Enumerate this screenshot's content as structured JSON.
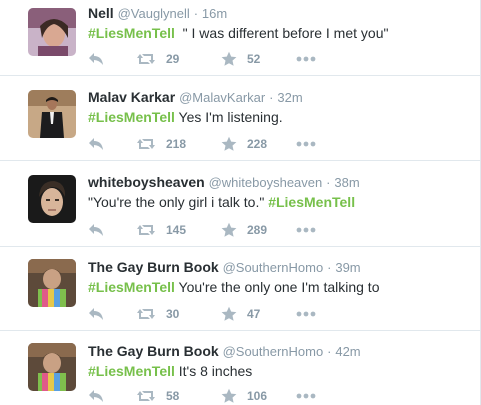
{
  "tweets": [
    {
      "fullname": "Nell",
      "username": "@Vauglynell",
      "sep": "·",
      "time": "16m",
      "text_before": "",
      "hashtag": "#LiesMenTell",
      "text_after": "  \" I was different before I met you\"",
      "retweets": "29",
      "favorites": "52",
      "avatar_color": "#b98f8a"
    },
    {
      "fullname": "Malav Karkar",
      "username": "@MalavKarkar",
      "sep": "·",
      "time": "32m",
      "text_before": "",
      "hashtag": "#LiesMenTell",
      "text_after": " Yes I'm listening.",
      "retweets": "218",
      "favorites": "228",
      "avatar_color": "#3a3a3a"
    },
    {
      "fullname": "whiteboysheaven",
      "username": "@whiteboysheaven",
      "sep": "·",
      "time": "38m",
      "text_before": "\"You're the only girl i talk to.\" ",
      "hashtag": "#LiesMenTell",
      "text_after": "",
      "retweets": "145",
      "favorites": "289",
      "avatar_color": "#2d2a28"
    },
    {
      "fullname": "The Gay Burn Book",
      "username": "@SouthernHomo",
      "sep": "·",
      "time": "39m",
      "text_before": "",
      "hashtag": "#LiesMenTell",
      "text_after": " You're the only one I'm talking to",
      "retweets": "30",
      "favorites": "47",
      "avatar_color": "#6b8f5e"
    },
    {
      "fullname": "The Gay Burn Book",
      "username": "@SouthernHomo",
      "sep": "·",
      "time": "42m",
      "text_before": "",
      "hashtag": "#LiesMenTell",
      "text_after": " It's 8 inches",
      "retweets": "58",
      "favorites": "106",
      "avatar_color": "#6b8f5e"
    }
  ],
  "colors": {
    "hashtag": "#77c04b",
    "meta": "#8899a6",
    "icon": "#aab8c2",
    "border": "#e1e8ed"
  },
  "icons": [
    "reply-icon",
    "retweet-icon",
    "favorite-icon",
    "more-icon"
  ]
}
